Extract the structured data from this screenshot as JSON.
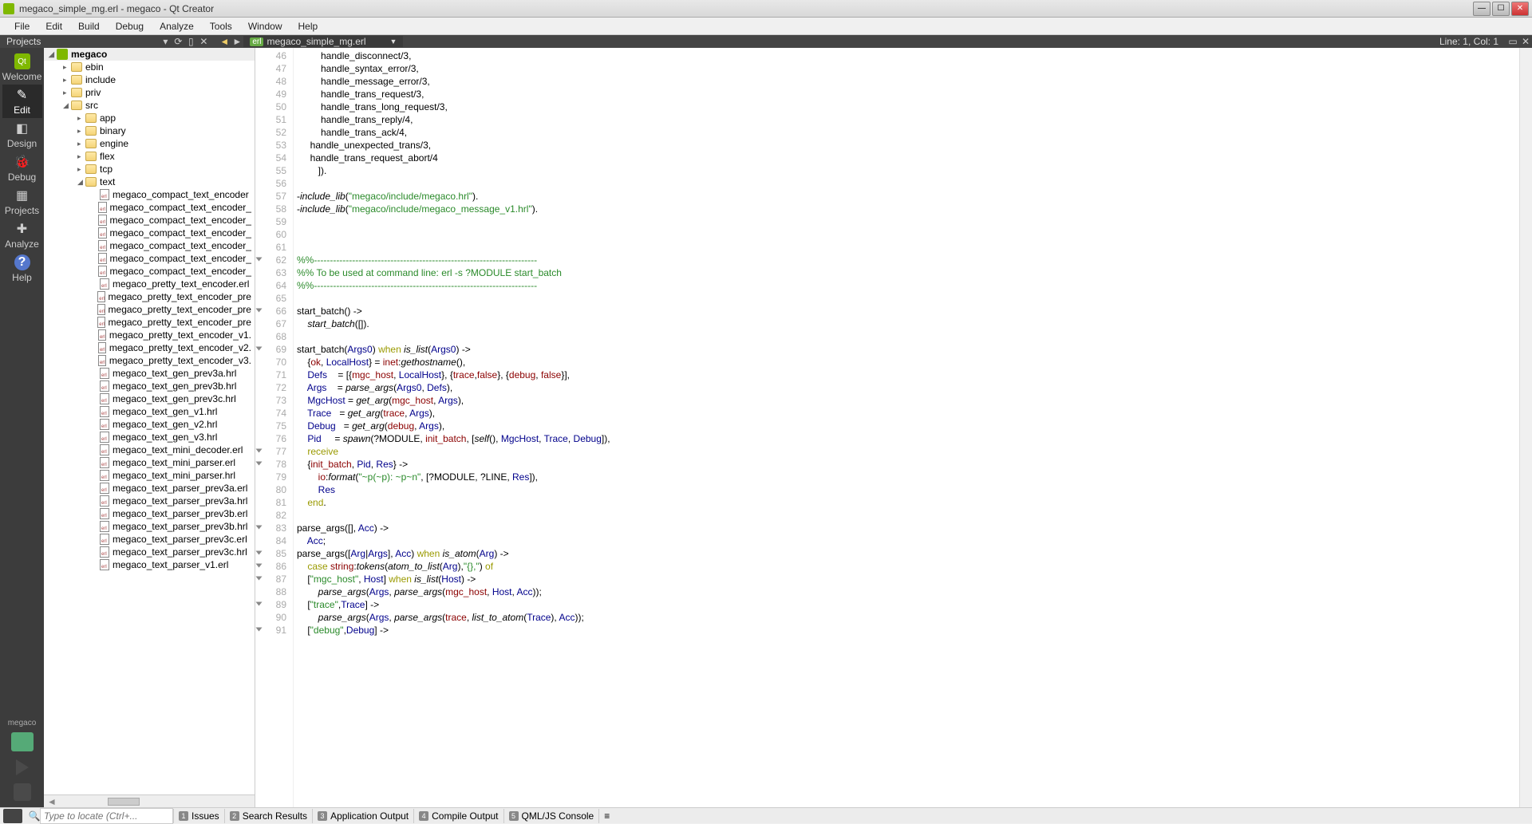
{
  "window": {
    "title": "megaco_simple_mg.erl - megaco - Qt Creator"
  },
  "menu": {
    "items": [
      "File",
      "Edit",
      "Build",
      "Debug",
      "Analyze",
      "Tools",
      "Window",
      "Help"
    ]
  },
  "toolbar": {
    "projects": "Projects",
    "file_label": "megaco_simple_mg.erl",
    "file_tag": "erl",
    "status": "Line: 1, Col: 1"
  },
  "modes": {
    "items": [
      {
        "label": "Welcome",
        "glyph": "Qt"
      },
      {
        "label": "Edit",
        "glyph": "✎"
      },
      {
        "label": "Design",
        "glyph": "◧"
      },
      {
        "label": "Debug",
        "glyph": "🐞"
      },
      {
        "label": "Projects",
        "glyph": "▦"
      },
      {
        "label": "Analyze",
        "glyph": "✚"
      },
      {
        "label": "Help",
        "glyph": "?"
      }
    ],
    "project_name": "megaco"
  },
  "tree": {
    "project": "megaco",
    "folders_l1": [
      {
        "name": "ebin"
      },
      {
        "name": "include"
      },
      {
        "name": "priv"
      }
    ],
    "src": "src",
    "folders_l2": [
      {
        "name": "app"
      },
      {
        "name": "binary"
      },
      {
        "name": "engine"
      },
      {
        "name": "flex"
      },
      {
        "name": "tcp"
      }
    ],
    "text": "text",
    "files": [
      "megaco_compact_text_encoder",
      "megaco_compact_text_encoder_",
      "megaco_compact_text_encoder_",
      "megaco_compact_text_encoder_",
      "megaco_compact_text_encoder_",
      "megaco_compact_text_encoder_",
      "megaco_compact_text_encoder_",
      "megaco_pretty_text_encoder.erl",
      "megaco_pretty_text_encoder_pre",
      "megaco_pretty_text_encoder_pre",
      "megaco_pretty_text_encoder_pre",
      "megaco_pretty_text_encoder_v1.",
      "megaco_pretty_text_encoder_v2.",
      "megaco_pretty_text_encoder_v3.",
      "megaco_text_gen_prev3a.hrl",
      "megaco_text_gen_prev3b.hrl",
      "megaco_text_gen_prev3c.hrl",
      "megaco_text_gen_v1.hrl",
      "megaco_text_gen_v2.hrl",
      "megaco_text_gen_v3.hrl",
      "megaco_text_mini_decoder.erl",
      "megaco_text_mini_parser.erl",
      "megaco_text_mini_parser.hrl",
      "megaco_text_parser_prev3a.erl",
      "megaco_text_parser_prev3a.hrl",
      "megaco_text_parser_prev3b.erl",
      "megaco_text_parser_prev3b.hrl",
      "megaco_text_parser_prev3c.erl",
      "megaco_text_parser_prev3c.hrl",
      "megaco_text_parser_v1.erl"
    ]
  },
  "editor": {
    "first_line": 46,
    "fold_lines": [
      62,
      66,
      69,
      77,
      78,
      83,
      85,
      86,
      87,
      89,
      91
    ],
    "lines": [
      {
        "n": 46,
        "html": "         handle_disconnect/3,"
      },
      {
        "n": 47,
        "html": "         handle_syntax_error/3,"
      },
      {
        "n": 48,
        "html": "         handle_message_error/3,"
      },
      {
        "n": 49,
        "html": "         handle_trans_request/3,"
      },
      {
        "n": 50,
        "html": "         handle_trans_long_request/3,"
      },
      {
        "n": 51,
        "html": "         handle_trans_reply/4,"
      },
      {
        "n": 52,
        "html": "         handle_trans_ack/4,"
      },
      {
        "n": 53,
        "html": "     handle_unexpected_trans/3,"
      },
      {
        "n": 54,
        "html": "     handle_trans_request_abort/4"
      },
      {
        "n": 55,
        "html": "        ])."
      },
      {
        "n": 56,
        "html": ""
      },
      {
        "n": 57,
        "html": "-<span class='c-func'>include_lib</span>(<span class='c-string'>\"megaco/include/megaco.hrl\"</span>)."
      },
      {
        "n": 58,
        "html": "-<span class='c-func'>include_lib</span>(<span class='c-string'>\"megaco/include/megaco_message_v1.hrl\"</span>)."
      },
      {
        "n": 59,
        "html": ""
      },
      {
        "n": 60,
        "html": ""
      },
      {
        "n": 61,
        "html": ""
      },
      {
        "n": 62,
        "html": "<span class='c-comment'>%%----------------------------------------------------------------------</span>"
      },
      {
        "n": 63,
        "html": "<span class='c-comment'>%% To be used at command line: erl -s ?MODULE start_batch</span>"
      },
      {
        "n": 64,
        "html": "<span class='c-comment'>%%----------------------------------------------------------------------</span>"
      },
      {
        "n": 65,
        "html": ""
      },
      {
        "n": 66,
        "html": "start_batch() -&gt;"
      },
      {
        "n": 67,
        "html": "    <span class='c-func'>start_batch</span>([])."
      },
      {
        "n": 68,
        "html": ""
      },
      {
        "n": 69,
        "html": "start_batch(<span class='c-var'>Args0</span>) <span class='c-keyword'>when</span> <span class='c-func'>is_list</span>(<span class='c-var'>Args0</span>) -&gt;"
      },
      {
        "n": 70,
        "html": "    {<span class='c-atom'>ok</span>, <span class='c-var'>LocalHost</span>} = <span class='c-atom'>inet</span>:<span class='c-func c-mod'>gethostname</span>(),"
      },
      {
        "n": 71,
        "html": "    <span class='c-var'>Defs</span>    = [{<span class='c-atom'>mgc_host</span>, <span class='c-var'>LocalHost</span>}, {<span class='c-atom'>trace</span>,<span class='c-atom'>false</span>}, {<span class='c-atom'>debug</span>, <span class='c-atom'>false</span>}],"
      },
      {
        "n": 72,
        "html": "    <span class='c-var'>Args</span>    = <span class='c-func'>parse_args</span>(<span class='c-var'>Args0</span>, <span class='c-var'>Defs</span>),"
      },
      {
        "n": 73,
        "html": "    <span class='c-var'>MgcHost</span> = <span class='c-func'>get_arg</span>(<span class='c-atom'>mgc_host</span>, <span class='c-var'>Args</span>),"
      },
      {
        "n": 74,
        "html": "    <span class='c-var'>Trace</span>   = <span class='c-func'>get_arg</span>(<span class='c-atom'>trace</span>, <span class='c-var'>Args</span>),"
      },
      {
        "n": 75,
        "html": "    <span class='c-var'>Debug</span>   = <span class='c-func'>get_arg</span>(<span class='c-atom'>debug</span>, <span class='c-var'>Args</span>),"
      },
      {
        "n": 76,
        "html": "    <span class='c-var'>Pid</span>     = <span class='c-func'>spawn</span>(?MODULE, <span class='c-atom'>init_batch</span>, [<span class='c-func'>self</span>(), <span class='c-var'>MgcHost</span>, <span class='c-var'>Trace</span>, <span class='c-var'>Debug</span>]),"
      },
      {
        "n": 77,
        "html": "    <span class='c-keyword'>receive</span>"
      },
      {
        "n": 78,
        "html": "    {<span class='c-atom'>init_batch</span>, <span class='c-var'>Pid</span>, <span class='c-var'>Res</span>} -&gt;"
      },
      {
        "n": 79,
        "html": "        <span class='c-atom'>io</span>:<span class='c-func c-mod'>format</span>(<span class='c-string'>\"~p(~p): ~p~n\"</span>, [?MODULE, ?LINE, <span class='c-var'>Res</span>]),"
      },
      {
        "n": 80,
        "html": "        <span class='c-var'>Res</span>"
      },
      {
        "n": 81,
        "html": "    <span class='c-keyword'>end</span>."
      },
      {
        "n": 82,
        "html": ""
      },
      {
        "n": 83,
        "html": "parse_args([], <span class='c-var'>Acc</span>) -&gt;"
      },
      {
        "n": 84,
        "html": "    <span class='c-var'>Acc</span>;"
      },
      {
        "n": 85,
        "html": "parse_args([<span class='c-var'>Arg</span>|<span class='c-var'>Args</span>], <span class='c-var'>Acc</span>) <span class='c-keyword'>when</span> <span class='c-func'>is_atom</span>(<span class='c-var'>Arg</span>) -&gt;"
      },
      {
        "n": 86,
        "html": "    <span class='c-keyword'>case</span> <span class='c-atom'>string</span>:<span class='c-func c-mod'>tokens</span>(<span class='c-func'>atom_to_list</span>(<span class='c-var'>Arg</span>),<span class='c-string'>\"{},\"</span>) <span class='c-keyword'>of</span>"
      },
      {
        "n": 87,
        "html": "    [<span class='c-string'>\"mgc_host\"</span>, <span class='c-var'>Host</span>] <span class='c-keyword'>when</span> <span class='c-func'>is_list</span>(<span class='c-var'>Host</span>) -&gt;"
      },
      {
        "n": 88,
        "html": "        <span class='c-func'>parse_args</span>(<span class='c-var'>Args</span>, <span class='c-func'>parse_args</span>(<span class='c-atom'>mgc_host</span>, <span class='c-var'>Host</span>, <span class='c-var'>Acc</span>));"
      },
      {
        "n": 89,
        "html": "    [<span class='c-string'>\"trace\"</span>,<span class='c-var'>Trace</span>] -&gt;"
      },
      {
        "n": 90,
        "html": "        <span class='c-func'>parse_args</span>(<span class='c-var'>Args</span>, <span class='c-func'>parse_args</span>(<span class='c-atom'>trace</span>, <span class='c-func'>list_to_atom</span>(<span class='c-var'>Trace</span>), <span class='c-var'>Acc</span>));"
      },
      {
        "n": 91,
        "html": "    [<span class='c-string'>\"debug\"</span>,<span class='c-var'>Debug</span>] -&gt;"
      }
    ]
  },
  "status": {
    "locator_placeholder": "Type to locate (Ctrl+...",
    "panes": [
      {
        "n": "1",
        "label": "Issues"
      },
      {
        "n": "2",
        "label": "Search Results"
      },
      {
        "n": "3",
        "label": "Application Output"
      },
      {
        "n": "4",
        "label": "Compile Output"
      },
      {
        "n": "5",
        "label": "QML/JS Console"
      }
    ]
  }
}
